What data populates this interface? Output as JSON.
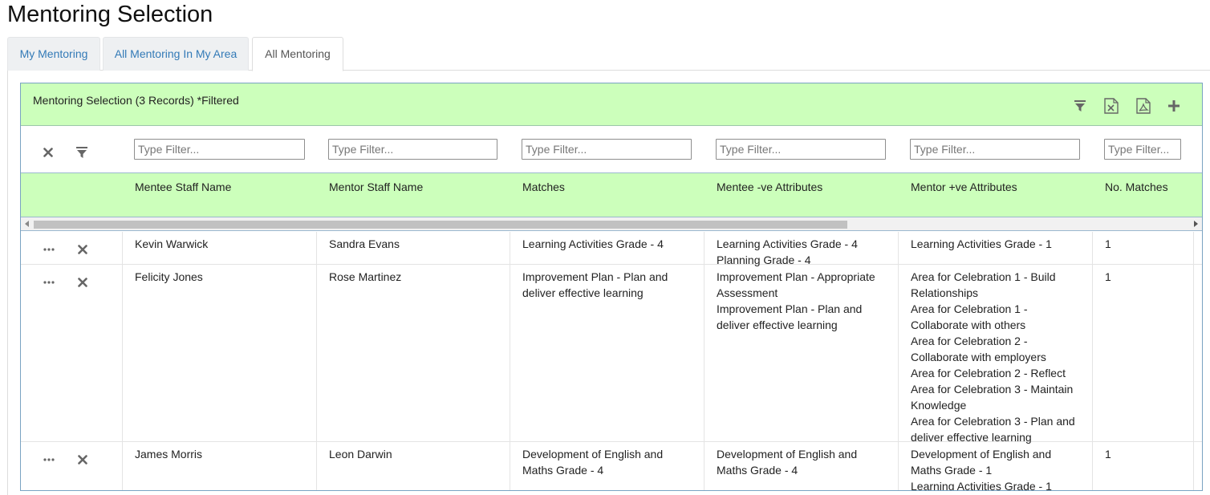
{
  "page": {
    "title": "Mentoring Selection"
  },
  "tabs": [
    {
      "label": "My Mentoring",
      "active": false
    },
    {
      "label": "All Mentoring In My Area",
      "active": false
    },
    {
      "label": "All Mentoring",
      "active": true
    }
  ],
  "panel": {
    "title": "Mentoring Selection (3 Records) *Filtered",
    "toolbar_icons": [
      "filter-icon",
      "excel-export-icon",
      "pdf-export-icon",
      "add-icon"
    ]
  },
  "filters": {
    "placeholder": "Type Filter...",
    "row_icons": [
      "clear-filter-icon",
      "filter-icon"
    ]
  },
  "columns": [
    "Mentee Staff Name",
    "Mentor Staff Name",
    "Matches",
    "Mentee -ve Attributes",
    "Mentor +ve Attributes",
    "No. Matches"
  ],
  "rows": [
    {
      "mentee": "Kevin Warwick",
      "mentor": "Sandra Evans",
      "matches": [
        "Learning Activities Grade - 4"
      ],
      "mentee_neg": [
        "Learning Activities Grade - 4",
        "Planning Grade - 4"
      ],
      "mentor_pos": [
        "Learning Activities Grade - 1"
      ],
      "no_matches": "1"
    },
    {
      "mentee": "Felicity Jones",
      "mentor": "Rose Martinez",
      "matches": [
        "Improvement Plan - Plan and deliver effective learning"
      ],
      "mentee_neg": [
        "Improvement Plan - Appropriate Assessment",
        "Improvement Plan - Plan and deliver effective learning"
      ],
      "mentor_pos": [
        "Area for Celebration 1 - Build Relationships",
        "Area for Celebration 1 - Collaborate with others",
        "Area for Celebration 2 - Collaborate with employers",
        "Area for Celebration 2 - Reflect",
        "Area for Celebration 3 - Maintain Knowledge",
        "Area for Celebration 3 - Plan and deliver effective learning"
      ],
      "no_matches": "1"
    },
    {
      "mentee": "James Morris",
      "mentor": "Leon Darwin",
      "matches": [
        "Development of English and Maths Grade - 4"
      ],
      "mentee_neg": [
        "Development of English and Maths Grade - 4"
      ],
      "mentor_pos": [
        "Development of English and Maths Grade - 1",
        "Learning Activities Grade - 1"
      ],
      "no_matches": "1"
    }
  ],
  "colors": {
    "header_bg": "#ccffbb",
    "panel_border": "#7aa3c2",
    "tab_link": "#337ab7",
    "icon_gray": "#666666"
  }
}
